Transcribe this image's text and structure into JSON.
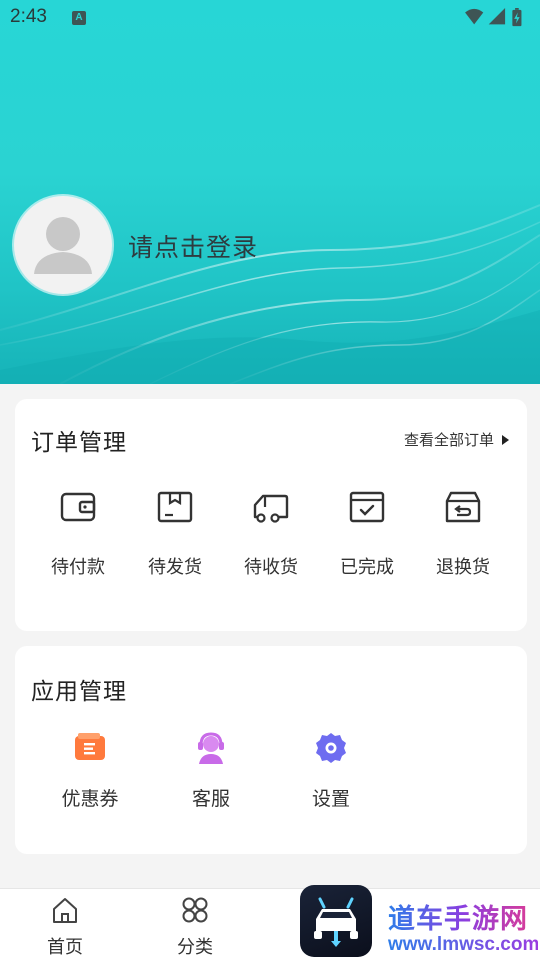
{
  "status_bar": {
    "time": "2:43",
    "badge": "A"
  },
  "profile": {
    "login_prompt": "请点击登录"
  },
  "orders": {
    "title": "订单管理",
    "view_all": "查看全部订单",
    "items": [
      {
        "label": "待付款",
        "icon": "wallet-icon"
      },
      {
        "label": "待发货",
        "icon": "package-box-icon"
      },
      {
        "label": "待收货",
        "icon": "delivery-truck-icon"
      },
      {
        "label": "已完成",
        "icon": "completed-box-icon"
      },
      {
        "label": "退换货",
        "icon": "return-box-icon"
      }
    ]
  },
  "apps": {
    "title": "应用管理",
    "items": [
      {
        "label": "优惠券",
        "icon": "coupon-icon",
        "color": "#ff7a3d"
      },
      {
        "label": "客服",
        "icon": "customer-service-icon",
        "color": "#c86be8"
      },
      {
        "label": "设置",
        "icon": "settings-gear-icon",
        "color": "#6e6cf0"
      }
    ]
  },
  "bottom_nav": {
    "items": [
      {
        "label": "首页",
        "icon": "home-icon"
      },
      {
        "label": "分类",
        "icon": "category-icon"
      }
    ]
  },
  "watermark": {
    "line1": "道车手游网",
    "line2": "www.lmwsc.com"
  },
  "colors": {
    "header_teal": "#2ad3d2",
    "background": "#f4f4f4"
  }
}
